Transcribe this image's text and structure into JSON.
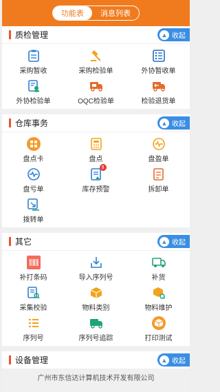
{
  "tabs": [
    "功能表",
    "消息列表"
  ],
  "collapse_label": "收起",
  "sections": [
    {
      "title": "质检管理",
      "items": [
        {
          "label": "采购暂收",
          "icon": "clipboard-icon"
        },
        {
          "label": "采购检验单",
          "icon": "gavel-icon"
        },
        {
          "label": "外协暂收单",
          "icon": "checklist-icon"
        },
        {
          "label": "外协检验单",
          "icon": "doc-user-icon"
        },
        {
          "label": "OQC检验单",
          "icon": "truck-icon"
        },
        {
          "label": "检验退货单",
          "icon": "return-truck-icon"
        }
      ]
    },
    {
      "title": "仓库事务",
      "items": [
        {
          "label": "盘点卡",
          "icon": "grid-circle-icon"
        },
        {
          "label": "盘点",
          "icon": "calculator-icon"
        },
        {
          "label": "盘盈单",
          "icon": "pulse-icon"
        },
        {
          "label": "盘亏单",
          "icon": "wave-icon"
        },
        {
          "label": "库存预警",
          "icon": "alert-doc-icon",
          "badge": "9"
        },
        {
          "label": "拆卸单",
          "icon": "split-icon"
        },
        {
          "label": "拨转单",
          "icon": "transfer-icon"
        }
      ]
    },
    {
      "title": "其它",
      "items": [
        {
          "label": "补打条码",
          "icon": "barcode-icon"
        },
        {
          "label": "导入序列号",
          "icon": "import-icon"
        },
        {
          "label": "补货",
          "icon": "restock-truck-icon"
        },
        {
          "label": "采集校验",
          "icon": "scan-doc-icon"
        },
        {
          "label": "物料类别",
          "icon": "box-icon"
        },
        {
          "label": "物料维护",
          "icon": "box-search-icon"
        },
        {
          "label": "序列号",
          "icon": "list-icon"
        },
        {
          "label": "序列号追踪",
          "icon": "track-truck-icon"
        },
        {
          "label": "打印测试",
          "icon": "print-box-icon"
        }
      ]
    },
    {
      "title": "设备管理",
      "items": []
    }
  ],
  "footer": "广州市东信达计算机技术开发有限公司",
  "colors": {
    "orange": "#f07b1e",
    "blue": "#3a8ee3",
    "red": "#e9552d"
  }
}
